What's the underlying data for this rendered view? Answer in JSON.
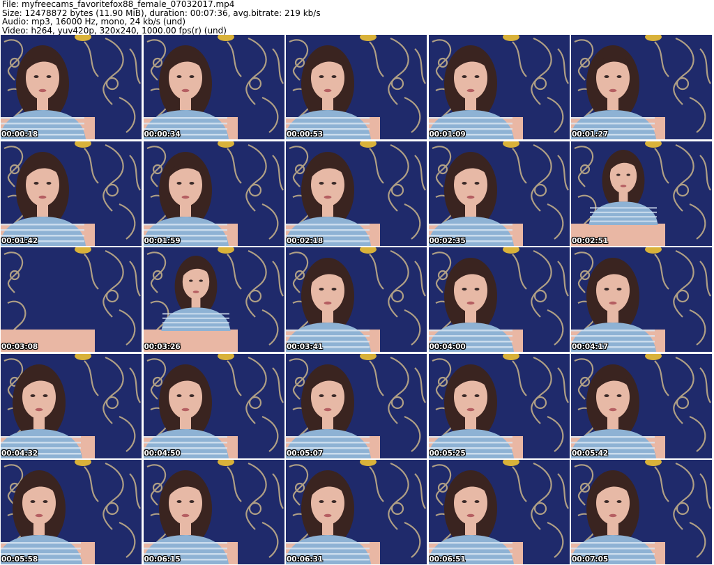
{
  "header": {
    "file_line": "File: myfreecams_favoritefox88_female_07032017.mp4",
    "size_line": "Size: 12478872 bytes (11.90 MiB), duration: 00:07:36, avg.bitrate: 219 kb/s",
    "audio_line": "Audio: mp3, 16000 Hz, mono, 24 kb/s (und)",
    "video_line": "Video: h264, yuv420p, 320x240, 1000.00 fps(r) (und)"
  },
  "colors": {
    "wallpaper": "#1f2a6b",
    "swirl": "#c9b48a",
    "shirt": "#8eb2d4",
    "stripe": "#d9e6f2",
    "hair": "#3a2420",
    "skin": "#e7b9a6",
    "couch": "#e9b7a4"
  },
  "thumbnails": [
    {
      "time": "00:00:18",
      "subject": "centered"
    },
    {
      "time": "00:00:34",
      "subject": "centered"
    },
    {
      "time": "00:00:53",
      "subject": "centered"
    },
    {
      "time": "00:01:09",
      "subject": "centered"
    },
    {
      "time": "00:01:27",
      "subject": "centered"
    },
    {
      "time": "00:01:42",
      "subject": "centered"
    },
    {
      "time": "00:01:59",
      "subject": "centered"
    },
    {
      "time": "00:02:18",
      "subject": "centered"
    },
    {
      "time": "00:02:35",
      "subject": "centered"
    },
    {
      "time": "00:02:51",
      "subject": "far"
    },
    {
      "time": "00:03:08",
      "subject": "none"
    },
    {
      "time": "00:03:26",
      "subject": "far"
    },
    {
      "time": "00:03:41",
      "subject": "centered"
    },
    {
      "time": "00:04:00",
      "subject": "centered"
    },
    {
      "time": "00:04:17",
      "subject": "centered"
    },
    {
      "time": "00:04:32",
      "subject": "left"
    },
    {
      "time": "00:04:50",
      "subject": "centered"
    },
    {
      "time": "00:05:07",
      "subject": "centered"
    },
    {
      "time": "00:05:25",
      "subject": "centered"
    },
    {
      "time": "00:05:42",
      "subject": "centered"
    },
    {
      "time": "00:05:58",
      "subject": "left"
    },
    {
      "time": "00:06:15",
      "subject": "centered"
    },
    {
      "time": "00:06:31",
      "subject": "centered"
    },
    {
      "time": "00:06:51",
      "subject": "centered"
    },
    {
      "time": "00:07:05",
      "subject": "centered"
    }
  ]
}
